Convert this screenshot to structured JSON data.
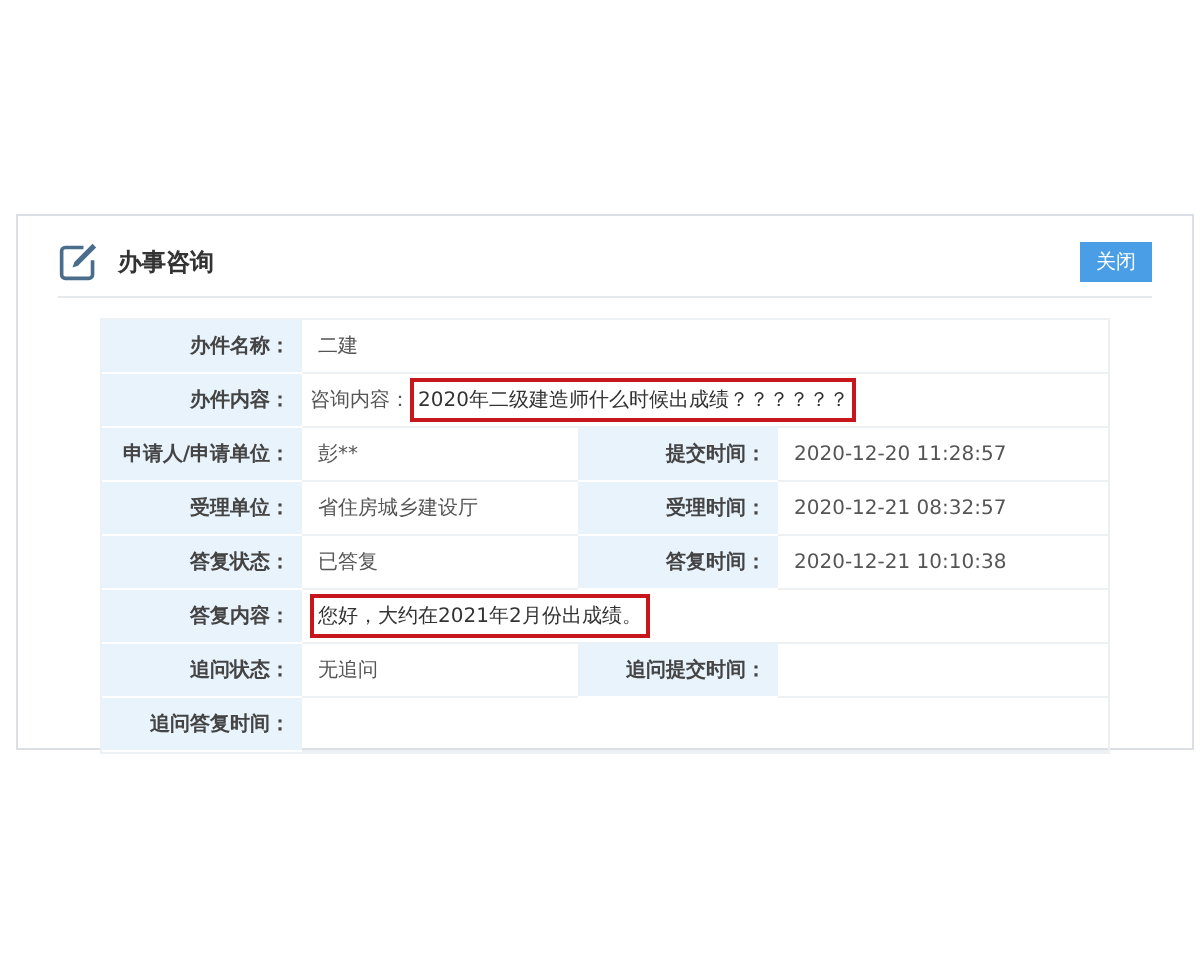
{
  "panel": {
    "title": "办事咨询",
    "close_button": "关闭"
  },
  "rows": [
    {
      "kind": "full",
      "cells": [
        {
          "label": "办件名称：",
          "value": "二建",
          "highlighted": false
        }
      ]
    },
    {
      "kind": "full",
      "cells": [
        {
          "label": "办件内容：",
          "prefix": "咨询内容：",
          "value": "2020年二级建造师什么时候出成绩？？？？？？",
          "highlighted": true
        }
      ]
    },
    {
      "kind": "pair",
      "cells": [
        {
          "label": "申请人/申请单位：",
          "value": "彭**",
          "highlighted": false
        },
        {
          "label": "提交时间：",
          "value": "2020-12-20 11:28:57",
          "highlighted": false
        }
      ]
    },
    {
      "kind": "pair",
      "cells": [
        {
          "label": "受理单位：",
          "value": "省住房城乡建设厅",
          "highlighted": false
        },
        {
          "label": "受理时间：",
          "value": "2020-12-21 08:32:57",
          "highlighted": false
        }
      ]
    },
    {
      "kind": "pair",
      "cells": [
        {
          "label": "答复状态：",
          "value": "已答复",
          "highlighted": false
        },
        {
          "label": "答复时间：",
          "value": "2020-12-21 10:10:38",
          "highlighted": false
        }
      ]
    },
    {
      "kind": "full",
      "cells": [
        {
          "label": "答复内容：",
          "value": "您好，大约在2021年2月份出成绩。",
          "highlighted": true
        }
      ]
    },
    {
      "kind": "pair",
      "cells": [
        {
          "label": "追问状态：",
          "value": "无追问",
          "highlighted": false
        },
        {
          "label": "追问提交时间："
        }
      ]
    },
    {
      "kind": "full",
      "cells": [
        {
          "label": "追问答复时间："
        }
      ]
    }
  ]
}
